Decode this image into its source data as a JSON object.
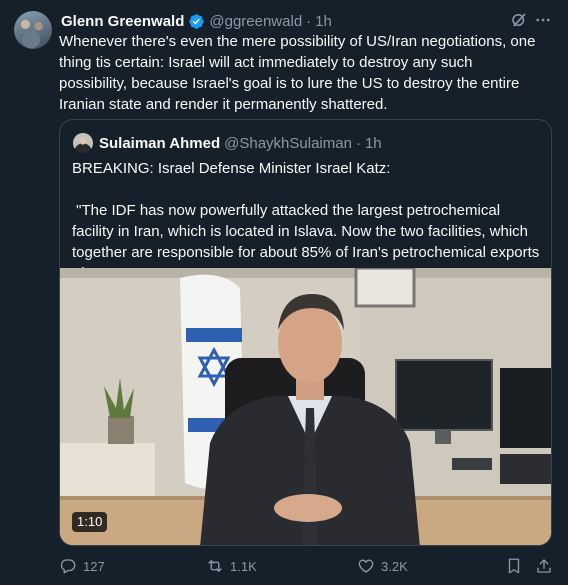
{
  "tweet": {
    "author_name": "Glenn Greenwald",
    "author_handle": "@ggreenwald",
    "separator": "·",
    "time": "1h",
    "text": "Whenever there's even the mere possibility of US/Iran negotiations, one thing tis certain: Israel will act immediately to destroy any such possibility, because Israel's goal is to lure the US to destroy the entire Iranian state and render it permanently shattered."
  },
  "quote": {
    "author_name": "Sulaiman Ahmed",
    "author_handle": "@ShaykhSulaiman",
    "separator": "·",
    "time": "1h",
    "text_line1": "BREAKING: Israel Defense Minister Israel Katz:",
    "text_line2": " \"The IDF has now powerfully attacked the largest petrochemical facility in Iran, which is located in Islava. Now the two facilities, which together are responsible for about 85% of Iran's petrochemical exports - have ..."
  },
  "media": {
    "duration": "1:10"
  },
  "actions": {
    "replies": "127",
    "reposts": "1.1K",
    "likes": "3.2K"
  },
  "colors": {
    "background": "#15202b",
    "secondary_text": "#8b98a5",
    "border": "#38444d",
    "verified": "#1d9bf0"
  },
  "icons": {
    "verified": "verified-badge-icon",
    "grok": "grok-icon",
    "more": "more-icon",
    "reply": "reply-icon",
    "repost": "repost-icon",
    "like": "like-icon",
    "bookmark": "bookmark-icon",
    "share": "share-icon"
  }
}
